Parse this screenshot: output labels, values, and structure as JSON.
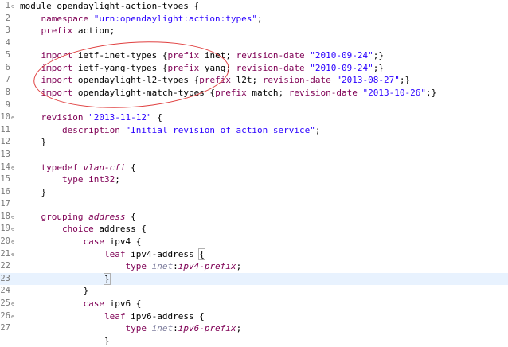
{
  "editor": {
    "lines": [
      {
        "n": "1",
        "fold": "⊖",
        "parts": [
          [
            "plain",
            "module opendaylight-action-types {"
          ]
        ]
      },
      {
        "n": "2",
        "fold": "",
        "parts": [
          [
            "plain",
            "    "
          ],
          [
            "kw",
            "namespace"
          ],
          [
            "plain",
            " "
          ],
          [
            "str",
            "\"urn:opendaylight:action:types\""
          ],
          [
            "plain",
            ";"
          ]
        ]
      },
      {
        "n": "3",
        "fold": "",
        "parts": [
          [
            "plain",
            "    "
          ],
          [
            "kw",
            "prefix"
          ],
          [
            "plain",
            " action;"
          ]
        ]
      },
      {
        "n": "4",
        "fold": "",
        "parts": []
      },
      {
        "n": "5",
        "fold": "",
        "parts": [
          [
            "plain",
            "    "
          ],
          [
            "kw",
            "import"
          ],
          [
            "plain",
            " ietf-inet-types {"
          ],
          [
            "kw",
            "prefix"
          ],
          [
            "plain",
            " inet; "
          ],
          [
            "kw",
            "revision-date"
          ],
          [
            "plain",
            " "
          ],
          [
            "str",
            "\"2010-09-24\""
          ],
          [
            "plain",
            ";}"
          ]
        ]
      },
      {
        "n": "6",
        "fold": "",
        "parts": [
          [
            "plain",
            "    "
          ],
          [
            "kw",
            "import"
          ],
          [
            "plain",
            " ietf-yang-types {"
          ],
          [
            "kw",
            "prefix"
          ],
          [
            "plain",
            " yang; "
          ],
          [
            "kw",
            "revision-date"
          ],
          [
            "plain",
            " "
          ],
          [
            "str",
            "\"2010-09-24\""
          ],
          [
            "plain",
            ";}"
          ]
        ]
      },
      {
        "n": "7",
        "fold": "",
        "parts": [
          [
            "plain",
            "    "
          ],
          [
            "kw",
            "import"
          ],
          [
            "plain",
            " opendaylight-l2-types {"
          ],
          [
            "kw",
            "prefix"
          ],
          [
            "plain",
            " l2t; "
          ],
          [
            "kw",
            "revision-date"
          ],
          [
            "plain",
            " "
          ],
          [
            "str",
            "\"2013-08-27\""
          ],
          [
            "plain",
            ";}"
          ]
        ]
      },
      {
        "n": "8",
        "fold": "",
        "parts": [
          [
            "plain",
            "    "
          ],
          [
            "kw",
            "import"
          ],
          [
            "plain",
            " opendaylight-match-types {"
          ],
          [
            "kw",
            "prefix"
          ],
          [
            "plain",
            " match; "
          ],
          [
            "kw",
            "revision-date"
          ],
          [
            "plain",
            " "
          ],
          [
            "str",
            "\"2013-10-26\""
          ],
          [
            "plain",
            ";}"
          ]
        ]
      },
      {
        "n": "9",
        "fold": "",
        "parts": []
      },
      {
        "n": "10",
        "fold": "⊖",
        "parts": [
          [
            "plain",
            "    "
          ],
          [
            "kw",
            "revision"
          ],
          [
            "plain",
            " "
          ],
          [
            "str",
            "\"2013-11-12\""
          ],
          [
            "plain",
            " {"
          ]
        ]
      },
      {
        "n": "11",
        "fold": "",
        "parts": [
          [
            "plain",
            "        "
          ],
          [
            "kw",
            "description"
          ],
          [
            "plain",
            " "
          ],
          [
            "str",
            "\"Initial revision of action service\""
          ],
          [
            "plain",
            ";"
          ]
        ]
      },
      {
        "n": "12",
        "fold": "",
        "parts": [
          [
            "plain",
            "    }"
          ]
        ]
      },
      {
        "n": "13",
        "fold": "",
        "parts": []
      },
      {
        "n": "14",
        "fold": "⊖",
        "parts": [
          [
            "plain",
            "    "
          ],
          [
            "kw",
            "typedef"
          ],
          [
            "plain",
            " "
          ],
          [
            "italic-type",
            "vlan-cfi"
          ],
          [
            "plain",
            " {"
          ]
        ]
      },
      {
        "n": "15",
        "fold": "",
        "parts": [
          [
            "plain",
            "        "
          ],
          [
            "kw",
            "type"
          ],
          [
            "plain",
            " "
          ],
          [
            "kw",
            "int32"
          ],
          [
            "plain",
            ";"
          ]
        ]
      },
      {
        "n": "16",
        "fold": "",
        "parts": [
          [
            "plain",
            "    }"
          ]
        ]
      },
      {
        "n": "17",
        "fold": "",
        "parts": []
      },
      {
        "n": "18",
        "fold": "⊖",
        "parts": [
          [
            "plain",
            "    "
          ],
          [
            "kw",
            "grouping"
          ],
          [
            "plain",
            " "
          ],
          [
            "italic-type",
            "address"
          ],
          [
            "plain",
            " {"
          ]
        ]
      },
      {
        "n": "19",
        "fold": "⊖",
        "parts": [
          [
            "plain",
            "        "
          ],
          [
            "kw",
            "choice"
          ],
          [
            "plain",
            " address {"
          ]
        ]
      },
      {
        "n": "20",
        "fold": "⊖",
        "parts": [
          [
            "plain",
            "            "
          ],
          [
            "kw",
            "case"
          ],
          [
            "plain",
            " ipv4 {"
          ]
        ]
      },
      {
        "n": "21",
        "fold": "⊖",
        "parts": [
          [
            "plain",
            "                "
          ],
          [
            "kw",
            "leaf"
          ],
          [
            "plain",
            " ipv4-address "
          ],
          [
            "box",
            "{"
          ]
        ]
      },
      {
        "n": "22",
        "fold": "",
        "parts": [
          [
            "plain",
            "                    "
          ],
          [
            "kw",
            "type"
          ],
          [
            "plain",
            " "
          ],
          [
            "prefix",
            "inet"
          ],
          [
            "plain",
            ":"
          ],
          [
            "italic-type",
            "ipv4-prefix"
          ],
          [
            "plain",
            ";"
          ]
        ]
      },
      {
        "n": "23",
        "fold": "",
        "current": true,
        "parts": [
          [
            "plain",
            "                "
          ],
          [
            "box",
            "}"
          ],
          [
            "cursor",
            ""
          ]
        ]
      },
      {
        "n": "24",
        "fold": "",
        "parts": [
          [
            "plain",
            "            }"
          ]
        ]
      },
      {
        "n": "25",
        "fold": "⊖",
        "parts": [
          [
            "plain",
            "            "
          ],
          [
            "kw",
            "case"
          ],
          [
            "plain",
            " ipv6 {"
          ]
        ]
      },
      {
        "n": "26",
        "fold": "⊖",
        "parts": [
          [
            "plain",
            "                "
          ],
          [
            "kw",
            "leaf"
          ],
          [
            "plain",
            " ipv6-address {"
          ]
        ]
      },
      {
        "n": "27",
        "fold": "",
        "parts": [
          [
            "plain",
            "                    "
          ],
          [
            "kw",
            "type"
          ],
          [
            "plain",
            " "
          ],
          [
            "prefix",
            "inet"
          ],
          [
            "plain",
            ":"
          ],
          [
            "italic-type",
            "ipv6-prefix"
          ],
          [
            "plain",
            ";"
          ]
        ]
      },
      {
        "n": "",
        "fold": "",
        "parts": [
          [
            "plain",
            "                }"
          ]
        ]
      }
    ]
  },
  "annotation": {
    "color": "#e04040",
    "shape": "ellipse"
  }
}
